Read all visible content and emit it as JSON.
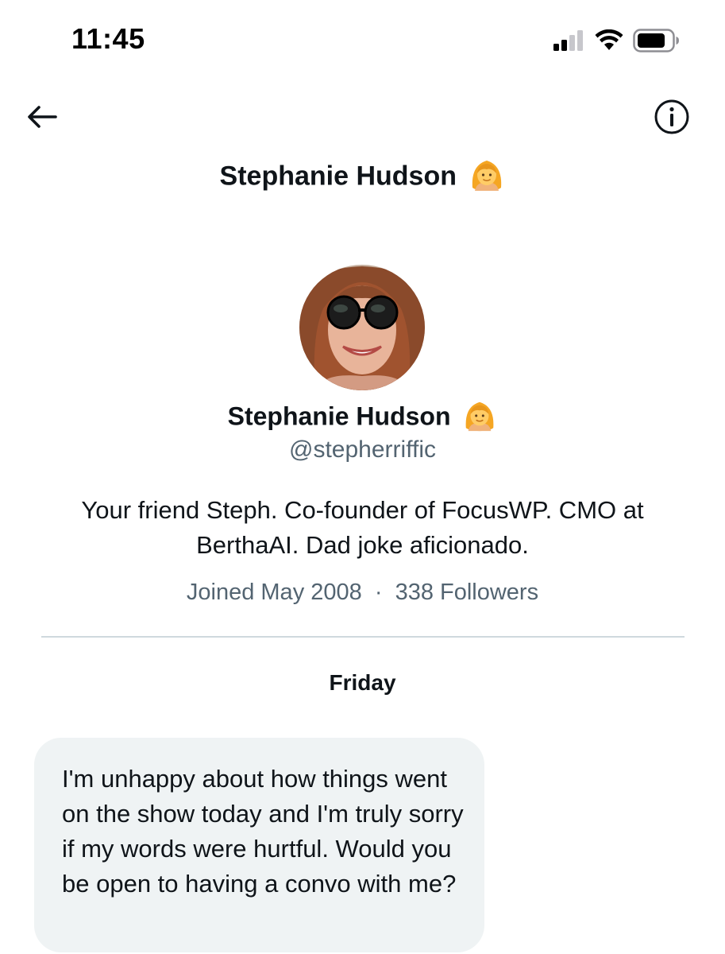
{
  "status_bar": {
    "time": "11:45",
    "icons": [
      "cellular-signal-icon",
      "wifi-icon",
      "battery-icon"
    ]
  },
  "header": {
    "back_icon": "arrow-left-icon",
    "info_icon": "info-circle-icon",
    "title": "Stephanie Hudson",
    "title_emoji": "woman-person-emoji"
  },
  "profile": {
    "name": "Stephanie Hudson",
    "name_emoji": "woman-person-emoji",
    "handle": "@stepherriffic",
    "bio": "Your friend Steph. Co-founder of FocusWP. CMO at BerthaAI. Dad joke aficionado.",
    "joined": "Joined May 2008",
    "separator": "·",
    "followers": "338 Followers"
  },
  "conversation": {
    "date_label": "Friday",
    "messages": [
      {
        "text": "I'm unhappy about how things went on the show today and I'm truly sorry if my words were hurtful. Would you be open to having a convo with me?"
      }
    ]
  },
  "colors": {
    "text_primary": "#0f1419",
    "text_secondary": "#536471",
    "bubble_bg": "#eff3f4",
    "divider": "#cfd9de"
  }
}
